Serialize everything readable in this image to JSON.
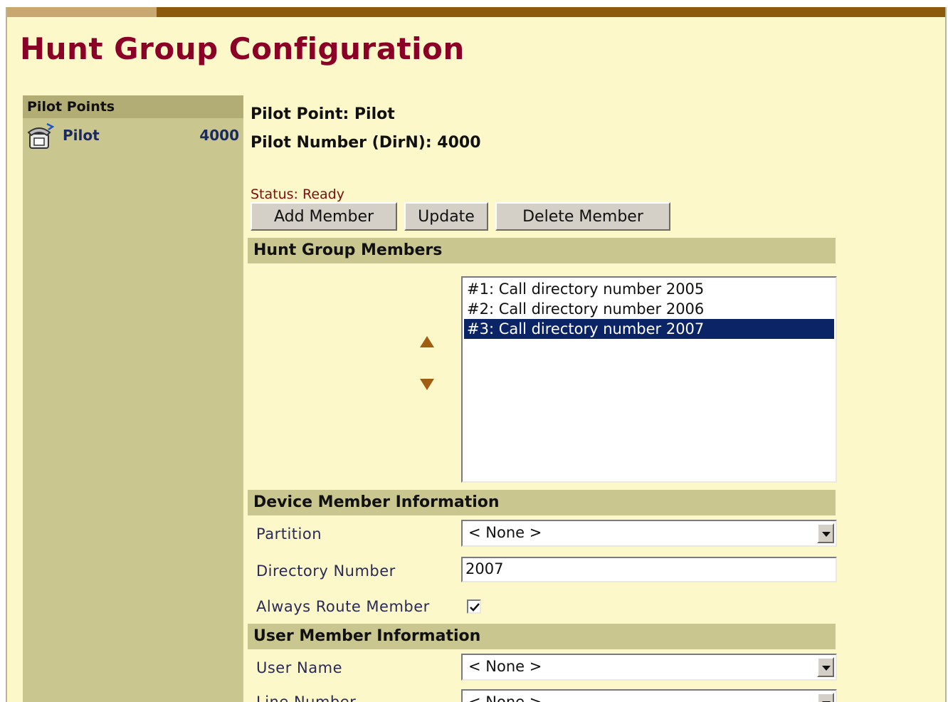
{
  "title": "Hunt Group Configuration",
  "sidebar": {
    "header": "Pilot Points",
    "items": [
      {
        "name": "Pilot",
        "number": "4000",
        "icon": "phone-icon"
      }
    ]
  },
  "pilot": {
    "point_label": "Pilot Point: Pilot",
    "number_label": "Pilot Number (DirN): 4000"
  },
  "status": "Status: Ready",
  "buttons": {
    "add_member": "Add Member",
    "update": "Update",
    "delete_member": "Delete Member"
  },
  "sections": {
    "members": "Hunt Group Members",
    "device": "Device Member Information",
    "user": "User Member Information"
  },
  "members": [
    "#1: Call directory number 2005",
    "#2: Call directory number 2006",
    "#3: Call directory number 2007"
  ],
  "selected_member_index": 2,
  "device": {
    "partition_label": "Partition",
    "partition_value": "< None >",
    "dirnum_label": "Directory Number",
    "dirnum_value": "2007",
    "always_route_label": "Always Route Member",
    "always_route_checked": true
  },
  "user": {
    "username_label": "User Name",
    "username_value": "< None >",
    "line_label": "Line Number",
    "line_value": "< None >"
  },
  "colors": {
    "title": "#8b0026",
    "selected": "#0a2466",
    "background": "#fdf8c9",
    "panel": "#cac68f"
  }
}
